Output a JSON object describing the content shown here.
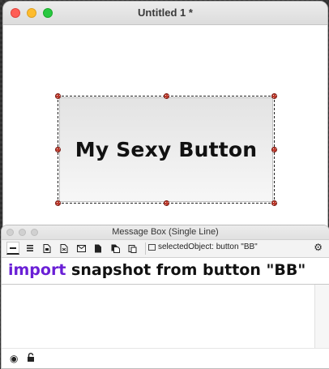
{
  "main_window": {
    "title": "Untitled 1 *"
  },
  "canvas": {
    "button_label": "My Sexy Button"
  },
  "message_box": {
    "title": "Message Box (Single Line)",
    "selected_object": "selectedObject: button \"BB\"",
    "command": {
      "keyword": "import",
      "rest": " snapshot from button \"BB\""
    },
    "toolbar_icons": [
      "single-line-icon",
      "multi-line-icon",
      "card-script-icon",
      "stack-script-icon",
      "message-icon",
      "script-icon",
      "copy-icon",
      "paste-icon"
    ]
  },
  "colors": {
    "keyword": "#6a1fd6",
    "handle": "#c0392b"
  }
}
